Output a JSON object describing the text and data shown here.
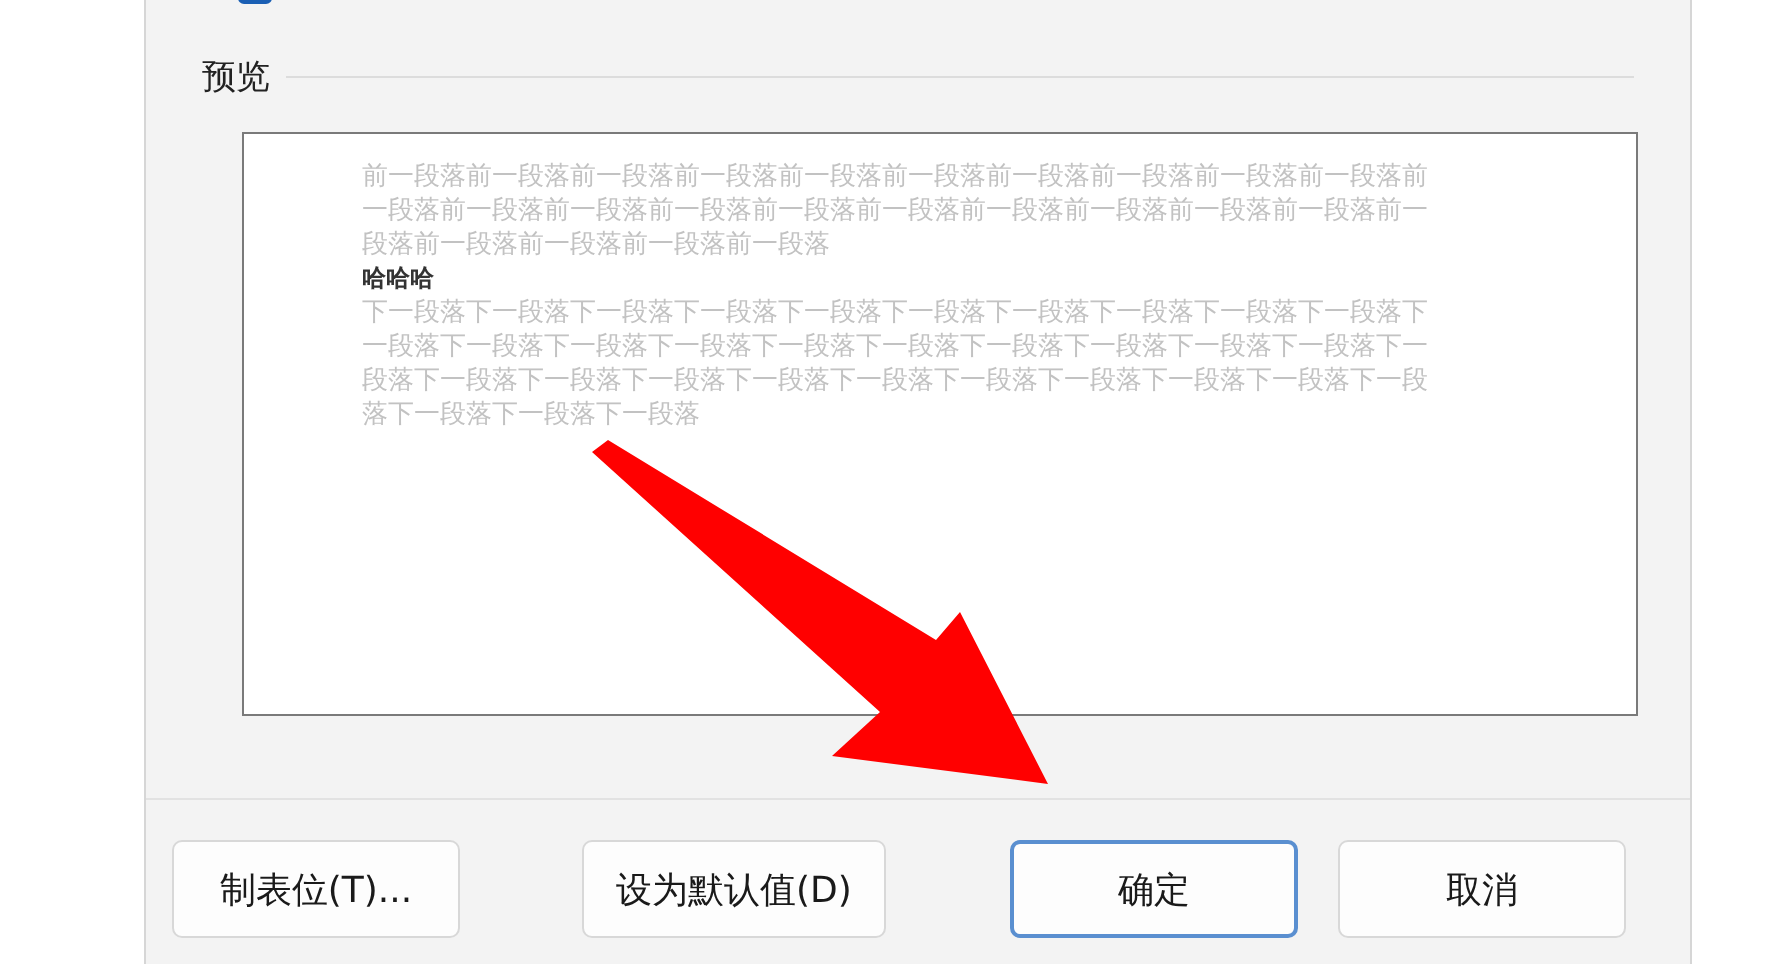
{
  "snap_checkbox": {
    "checked": true
  },
  "preview": {
    "title": "预览",
    "previous_paragraph": "前一段落前一段落前一段落前一段落前一段落前一段落前一段落前一段落前一段落前一段落前一段落前一段落前一段落前一段落前一段落前一段落前一段落前一段落前一段落前一段落前一段落前一段落前一段落前一段落前一段落",
    "current_paragraph": "哈哈哈",
    "next_paragraph": "下一段落下一段落下一段落下一段落下一段落下一段落下一段落下一段落下一段落下一段落下一段落下一段落下一段落下一段落下一段落下一段落下一段落下一段落下一段落下一段落下一段落下一段落下一段落下一段落下一段落下一段落下一段落下一段落下一段落下一段落下一段落下一段落下一段落下一段落"
  },
  "buttons": [
    {
      "label": "制表位(T)...",
      "kind": "normal"
    },
    {
      "label": "设为默认值(D)",
      "kind": "normal"
    },
    {
      "label": "确定",
      "kind": "default"
    },
    {
      "label": "取消",
      "kind": "normal"
    }
  ]
}
